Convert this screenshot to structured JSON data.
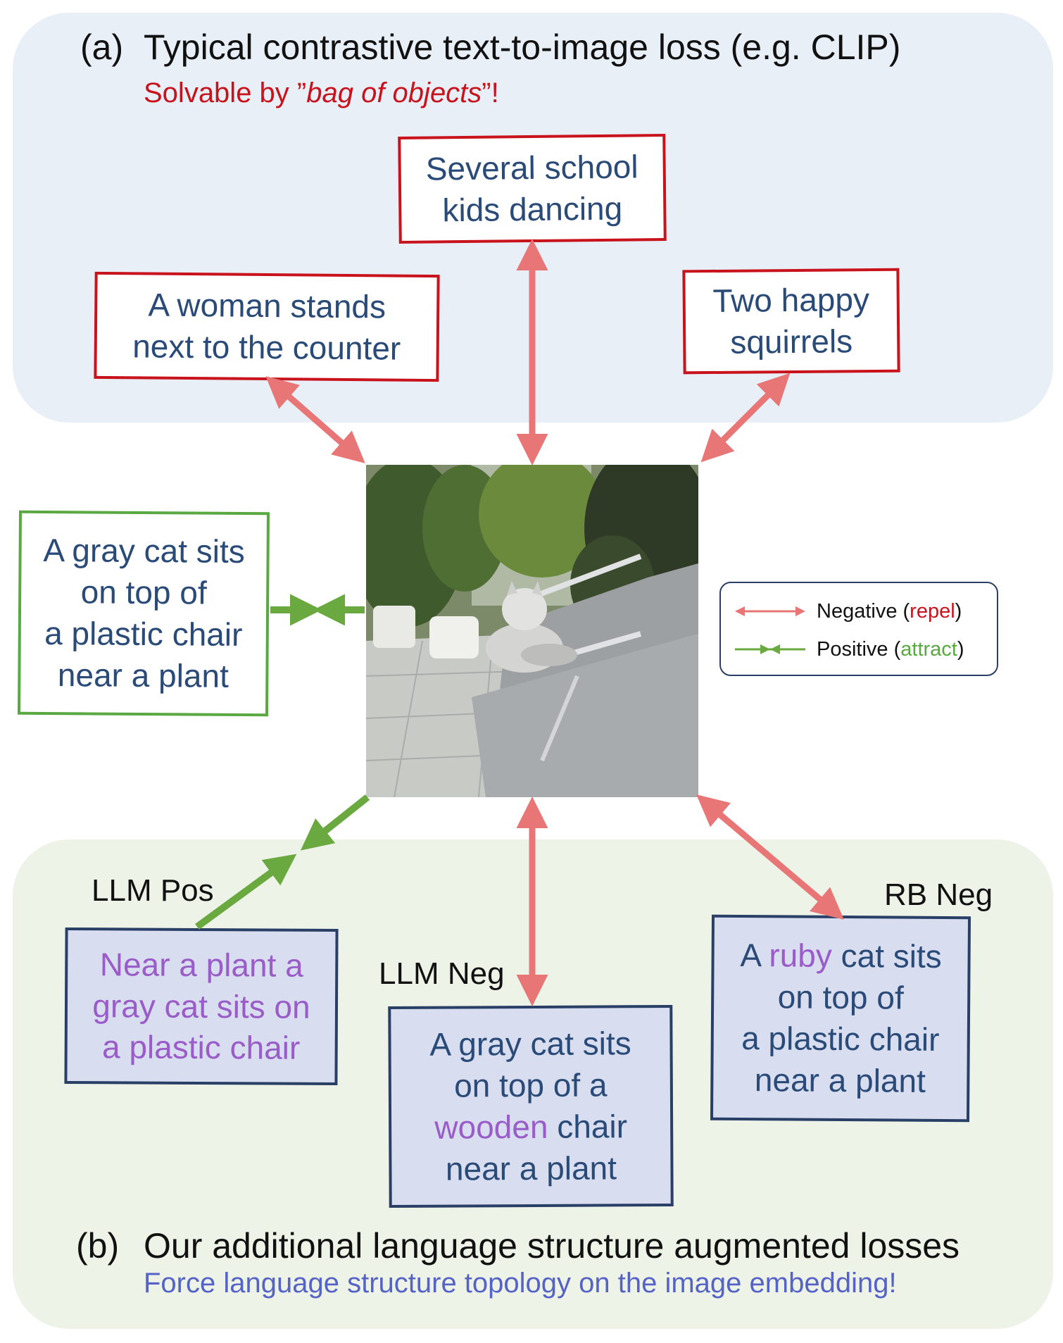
{
  "panel_a": {
    "letter": "(a)",
    "title": "Typical contrastive text-to-image loss (e.g. CLIP)",
    "subtitle_prefix": "Solvable by ”",
    "subtitle_emphasis": "bag of objects",
    "subtitle_suffix": "”!"
  },
  "negatives": {
    "top": "Several school\nkids dancing",
    "left": "A woman stands\nnext to the counter",
    "right": "Two happy\nsquirrels"
  },
  "positive": "A gray cat sits\non top of\na plastic chair\nnear a plant",
  "legend": {
    "negative_label": "Negative (",
    "negative_word": "repel",
    "positive_label": "Positive (",
    "positive_word": "attract",
    "close": ")",
    "colors": {
      "negative": "#e87676",
      "positive": "#6aa840"
    }
  },
  "augmented": {
    "llm_pos": {
      "tag": "LLM Pos",
      "line1": "Near a plant a",
      "line2": "gray cat sits on",
      "line3": "a plastic chair"
    },
    "llm_neg": {
      "tag": "LLM Neg",
      "line1": "A gray cat sits",
      "line2": "on top of a",
      "line3_swap": "wooden",
      "line3_rest": " chair",
      "line4": "near a plant"
    },
    "rb_neg": {
      "tag": "RB Neg",
      "line1_pre": "A ",
      "line1_swap": "ruby",
      "line1_rest": " cat sits",
      "line2": "on top of",
      "line3": "a plastic chair",
      "line4": "near a plant"
    }
  },
  "panel_b": {
    "letter": "(b)",
    "title": "Our additional language structure augmented losses",
    "subtitle": "Force language structure topology on the image embedding!"
  }
}
